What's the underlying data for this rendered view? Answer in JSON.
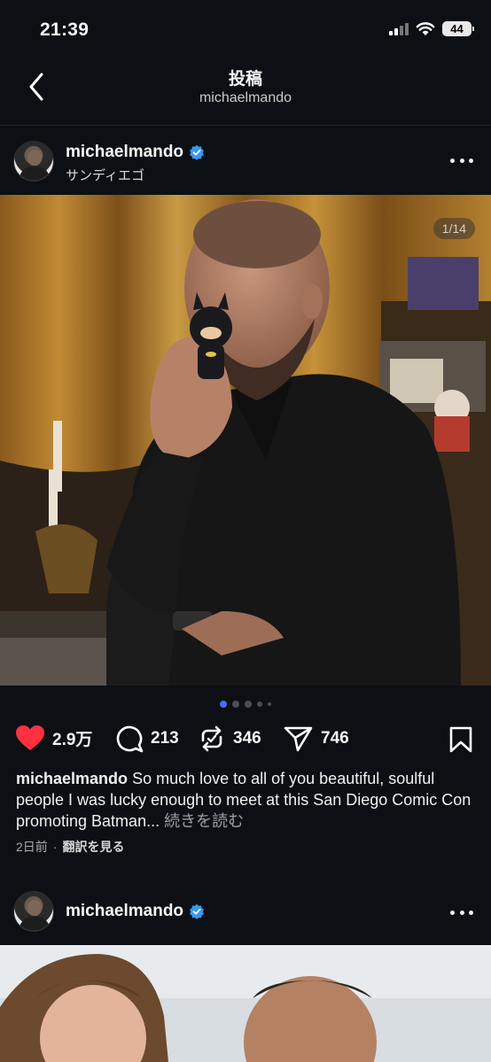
{
  "status_bar": {
    "time": "21:39",
    "battery": "44"
  },
  "nav": {
    "title": "投稿",
    "subtitle": "michaelmando"
  },
  "post": {
    "username": "michaelmando",
    "location": "サンディエゴ",
    "image_counter": "1/14",
    "carousel": {
      "total_dots": 5,
      "active_index": 0
    },
    "likes": "2.9万",
    "comments": "213",
    "reposts": "346",
    "shares": "746",
    "caption_user": "michaelmando",
    "caption_text": "So much love to all of you beautiful, soulful people I was lucky enough to meet at this San Diego Comic Con promoting Batman...",
    "caption_more": "続きを読む",
    "time_ago": "2日前",
    "separator": "·",
    "translate": "翻訳を見る"
  },
  "next_post": {
    "username": "michaelmando"
  },
  "colors": {
    "background": "#0c1014",
    "like_red": "#ff3040",
    "verified_blue": "#3897f0",
    "active_dot": "#4a6cf7"
  }
}
